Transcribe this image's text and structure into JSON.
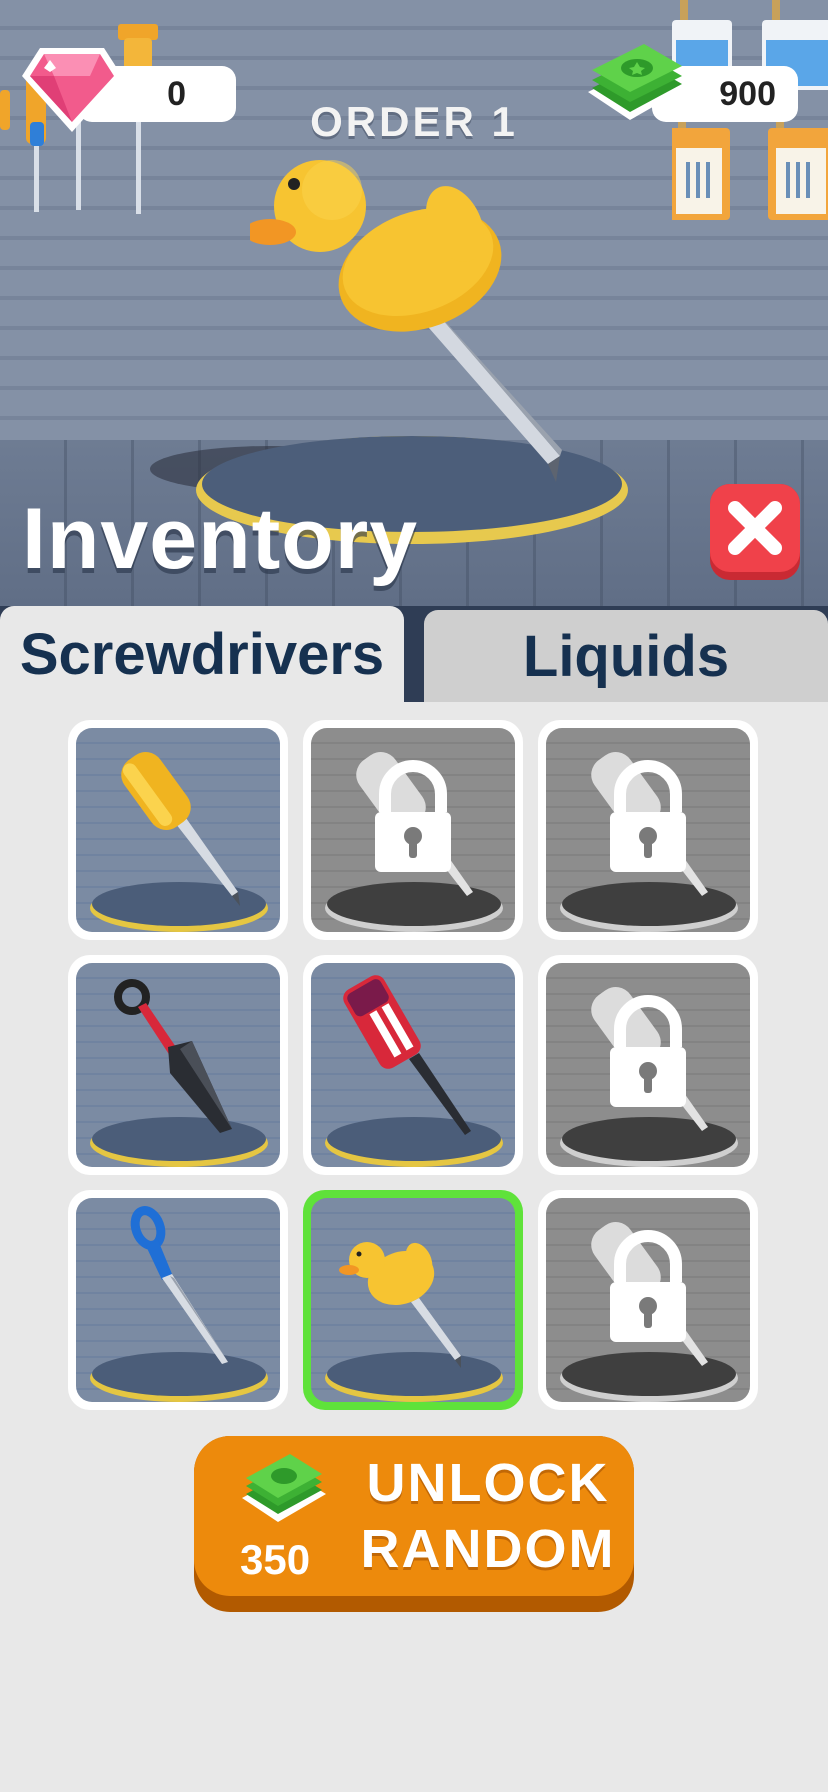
{
  "hud": {
    "gems": "0",
    "cash": "900",
    "order_title": "ORDER 1"
  },
  "panel": {
    "title": "Inventory",
    "close_icon": "close-x-icon"
  },
  "tabs": [
    {
      "label": "Screwdrivers",
      "active": true
    },
    {
      "label": "Liquids",
      "active": false
    }
  ],
  "items": [
    {
      "name": "yellow-screwdriver",
      "locked": false,
      "selected": false
    },
    {
      "name": "locked",
      "locked": true,
      "selected": false
    },
    {
      "name": "locked",
      "locked": true,
      "selected": false
    },
    {
      "name": "kunai",
      "locked": false,
      "selected": false
    },
    {
      "name": "red-screwdriver",
      "locked": false,
      "selected": false
    },
    {
      "name": "locked",
      "locked": true,
      "selected": false
    },
    {
      "name": "scissor-blade",
      "locked": false,
      "selected": false
    },
    {
      "name": "duck-screwdriver",
      "locked": false,
      "selected": true
    },
    {
      "name": "locked",
      "locked": true,
      "selected": false
    }
  ],
  "unlock": {
    "label_line1": "UNLOCK",
    "label_line2": "RANDOM",
    "price": "350"
  },
  "colors": {
    "selected_border": "#5fe23a",
    "unlock_button": "#ed8a0c",
    "close_button": "#f0414a",
    "tab_text": "#163150"
  }
}
